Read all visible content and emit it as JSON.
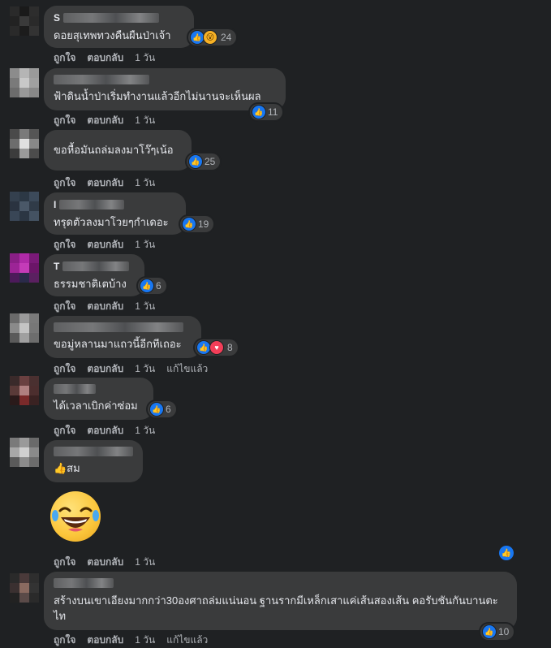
{
  "actions": {
    "like": "ถูกใจ",
    "reply": "ตอบกลับ",
    "edited": "แก้ไขแล้ว"
  },
  "comments": [
    {
      "name_initial": "S",
      "text": "ดอยสุเทพทวงคืนผืนป่าเจ้า",
      "reaction_count": "24",
      "reactions": [
        "like-icon",
        "wow-icon"
      ],
      "time": "1 วัน"
    },
    {
      "name_initial": "",
      "text": "ฟ้าดินน้ำป่าเริ่มทำงานแล้วอีกไม่นานจะเห็นผล",
      "reaction_count": "11",
      "reactions": [
        "like-icon"
      ],
      "time": "1 วัน"
    },
    {
      "name_initial": "",
      "text": "ขอหื้อมันถล่มลงมาโว๊ๆเน้อ",
      "reaction_count": "25",
      "reactions": [
        "like-icon"
      ],
      "time": "1 วัน"
    },
    {
      "name_initial": "I",
      "text": "ทรุดตัวลงมาโวยๆกำเดอะ",
      "reaction_count": "19",
      "reactions": [
        "like-icon"
      ],
      "time": "1 วัน"
    },
    {
      "name_initial": "T",
      "text": "ธรรมชาติเตบ้าง",
      "reaction_count": "6",
      "reactions": [
        "like-icon"
      ],
      "time": "1 วัน"
    },
    {
      "name_initial": "",
      "text": "ขอมู่หลานมาแถวนี้อีกทีเถอะ",
      "reaction_count": "8",
      "reactions": [
        "like-icon",
        "love-icon"
      ],
      "time": "1 วัน",
      "edited": true
    },
    {
      "name_initial": "",
      "text": "ได้เวลาเบิกค่าซ่อม",
      "reaction_count": "6",
      "reactions": [
        "like-icon"
      ],
      "time": "1 วัน"
    },
    {
      "name_initial": "",
      "text": "👍สม",
      "time": "1 วัน"
    },
    {
      "name_initial": "",
      "text": "สร้างบนเขาเอียงมากกว่า30องศาถล่มแน่นอน ฐานรากมีเหล็กเสาแค่เส้นสองเส้น คอรับชันกันบานตะไท",
      "reaction_count": "10",
      "reactions": [
        "like-icon"
      ],
      "time": "1 วัน",
      "edited": true
    }
  ],
  "colors": {
    "background": "#1f2123",
    "bubble": "#3a3b3c",
    "like": "#1877f2",
    "love": "#f33e58",
    "wow": "#f7b125"
  }
}
